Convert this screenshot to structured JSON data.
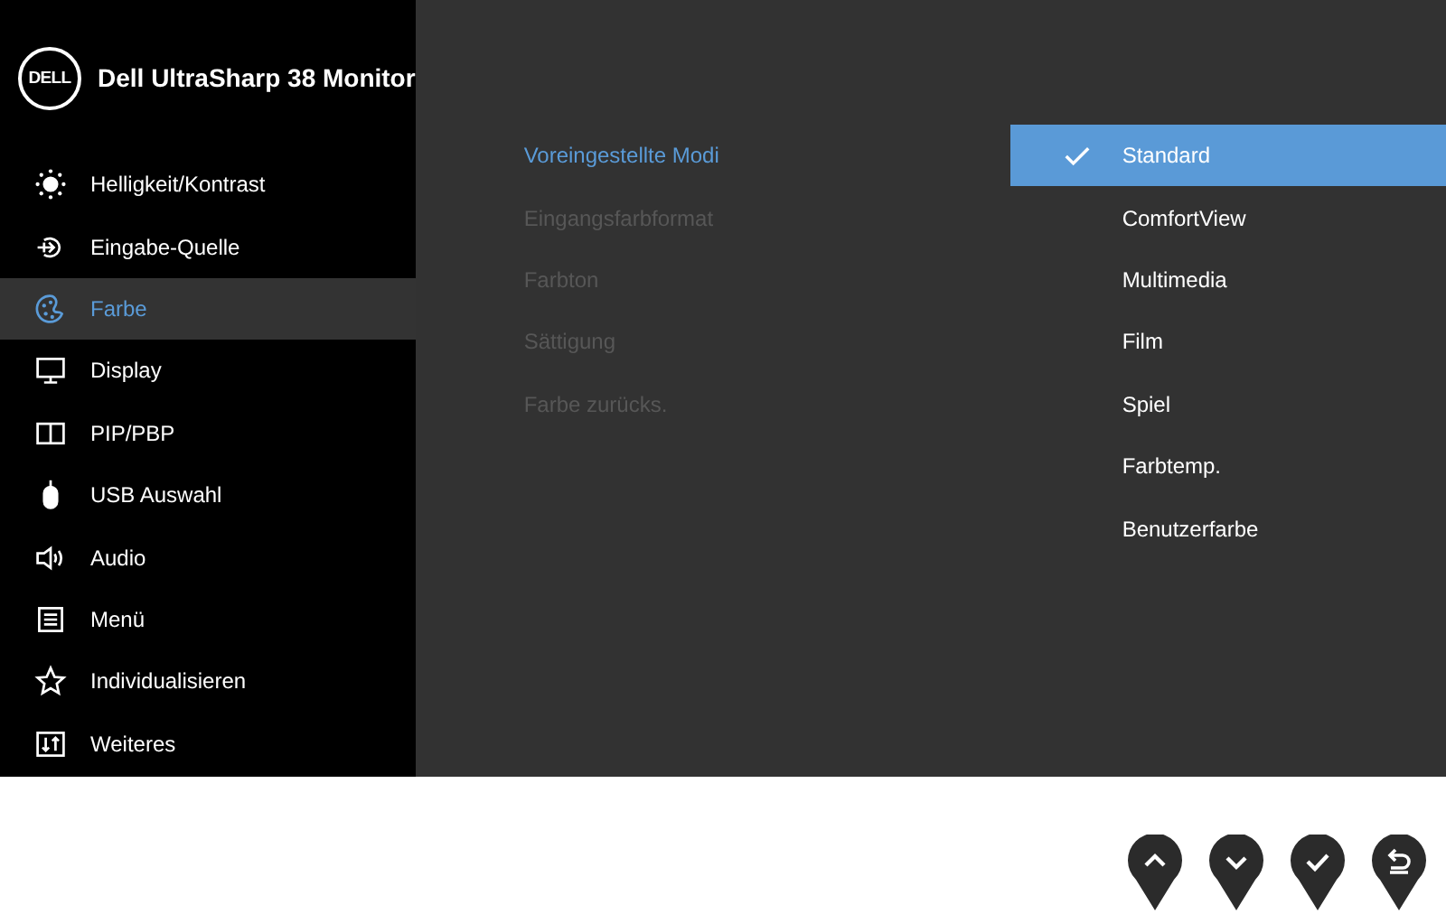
{
  "header": {
    "logo": "DELL",
    "title": "Dell UltraSharp 38 Monitor"
  },
  "menu": [
    {
      "kind": "brightness",
      "label": "Helligkeit/Kontrast",
      "selected": false
    },
    {
      "kind": "input",
      "label": "Eingabe-Quelle",
      "selected": false
    },
    {
      "kind": "color",
      "label": "Farbe",
      "selected": true
    },
    {
      "kind": "display",
      "label": "Display",
      "selected": false
    },
    {
      "kind": "pip",
      "label": "PIP/PBP",
      "selected": false
    },
    {
      "kind": "usb",
      "label": "USB Auswahl",
      "selected": false
    },
    {
      "kind": "audio",
      "label": "Audio",
      "selected": false
    },
    {
      "kind": "menu",
      "label": "Menü",
      "selected": false
    },
    {
      "kind": "personalize",
      "label": "Individualisieren",
      "selected": false
    },
    {
      "kind": "others",
      "label": "Weiteres",
      "selected": false
    }
  ],
  "submenu": [
    {
      "label": "Voreingestellte Modi",
      "selected": true,
      "disabled": false
    },
    {
      "label": "Eingangsfarbformat",
      "selected": false,
      "disabled": true
    },
    {
      "label": "Farbton",
      "selected": false,
      "disabled": true
    },
    {
      "label": "Sättigung",
      "selected": false,
      "disabled": true
    },
    {
      "label": "Farbe zurücks.",
      "selected": false,
      "disabled": true
    }
  ],
  "options": [
    {
      "label": "Standard",
      "selected": true
    },
    {
      "label": "ComfortView",
      "selected": false
    },
    {
      "label": "Multimedia",
      "selected": false
    },
    {
      "label": "Film",
      "selected": false
    },
    {
      "label": "Spiel",
      "selected": false
    },
    {
      "label": "Farbtemp.",
      "selected": false
    },
    {
      "label": "Benutzerfarbe",
      "selected": false
    }
  ],
  "buttons": [
    {
      "kind": "up"
    },
    {
      "kind": "down"
    },
    {
      "kind": "ok"
    },
    {
      "kind": "back"
    }
  ]
}
